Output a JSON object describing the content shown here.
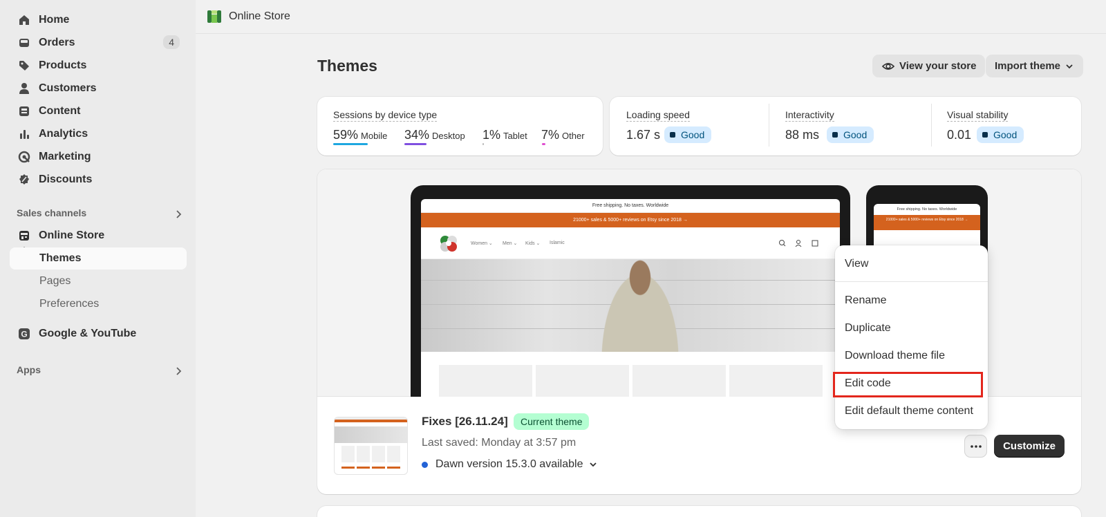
{
  "sidebar": {
    "items": [
      {
        "label": "Home",
        "icon": "home-icon"
      },
      {
        "label": "Orders",
        "icon": "inbox-icon",
        "badge": "4"
      },
      {
        "label": "Products",
        "icon": "tag-icon"
      },
      {
        "label": "Customers",
        "icon": "person-icon"
      },
      {
        "label": "Content",
        "icon": "content-icon"
      },
      {
        "label": "Analytics",
        "icon": "bar-chart-icon"
      },
      {
        "label": "Marketing",
        "icon": "target-icon"
      },
      {
        "label": "Discounts",
        "icon": "discount-icon"
      }
    ],
    "sales_channels_title": "Sales channels",
    "online_store": "Online Store",
    "sub_items": [
      "Themes",
      "Pages",
      "Preferences"
    ],
    "google": "Google & YouTube",
    "apps_title": "Apps"
  },
  "header": {
    "title": "Online Store"
  },
  "page": {
    "title": "Themes",
    "view_store": "View your store",
    "import_theme": "Import theme"
  },
  "sessions": {
    "title": "Sessions by device type",
    "devices": [
      {
        "pct": "59%",
        "label": "Mobile",
        "color": "#1ea7e0"
      },
      {
        "pct": "34%",
        "label": "Desktop",
        "color": "#7f4fe0"
      },
      {
        "pct": "1%",
        "label": "Tablet",
        "color": "#b8b8b8"
      },
      {
        "pct": "7%",
        "label": "Other",
        "color": "#e04fd0"
      }
    ]
  },
  "web_vitals": [
    {
      "title": "Loading speed",
      "value": "1.67 s",
      "status": "Good"
    },
    {
      "title": "Interactivity",
      "value": "88 ms",
      "status": "Good"
    },
    {
      "title": "Visual stability",
      "value": "0.01",
      "status": "Good"
    }
  ],
  "preview": {
    "announcement": "Free shipping. No taxes. Worldwide",
    "promo": "21000+ sales & 5000+ reviews on Etsy since 2018 →",
    "menu": [
      "Women ⌄",
      "Men ⌄",
      "Kids ⌄",
      "Islamic"
    ]
  },
  "theme": {
    "name": "Fixes [26.11.24]",
    "badge": "Current theme",
    "saved": "Last saved: Monday at 3:57 pm",
    "version": "Dawn version 15.3.0 available",
    "customize": "Customize"
  },
  "menu": {
    "items": [
      "View",
      "Rename",
      "Duplicate",
      "Download theme file",
      "Edit code",
      "Edit default theme content"
    ]
  }
}
